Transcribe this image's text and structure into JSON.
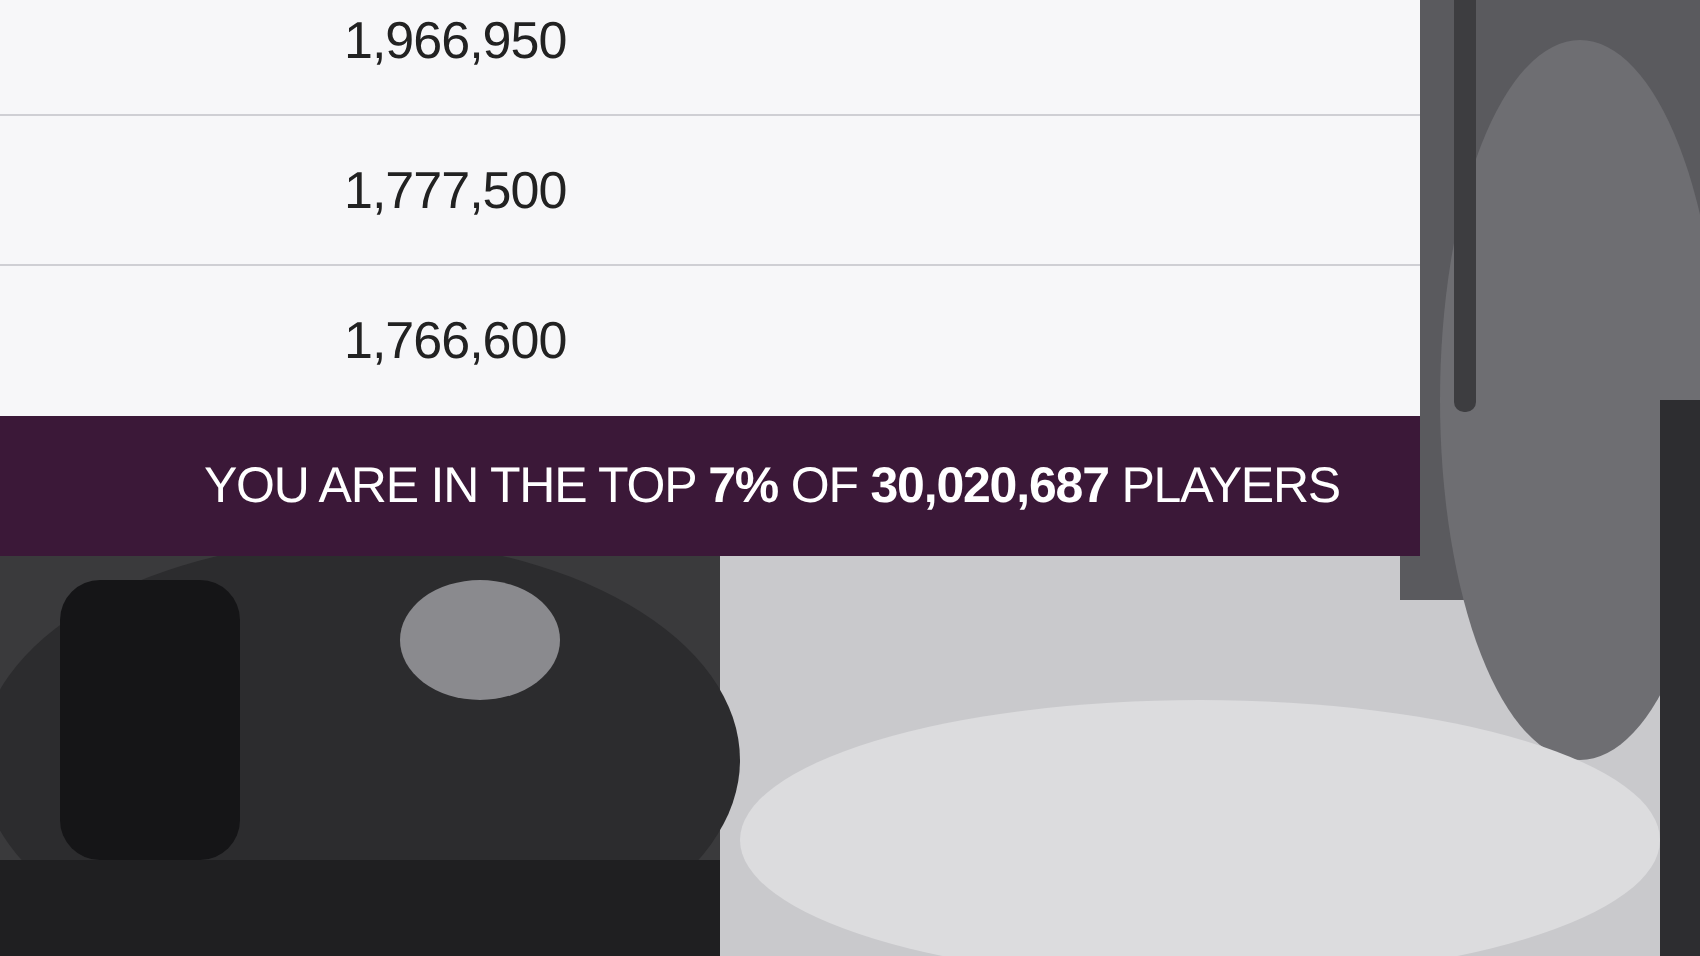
{
  "leaderboard": {
    "rows": [
      {
        "score": "1,966,950"
      },
      {
        "score": "1,777,500"
      },
      {
        "score": "1,766,600"
      }
    ],
    "banner": "YOU ARE IN THE TOP **7%** OF **30,020,687** PLAYERS"
  }
}
